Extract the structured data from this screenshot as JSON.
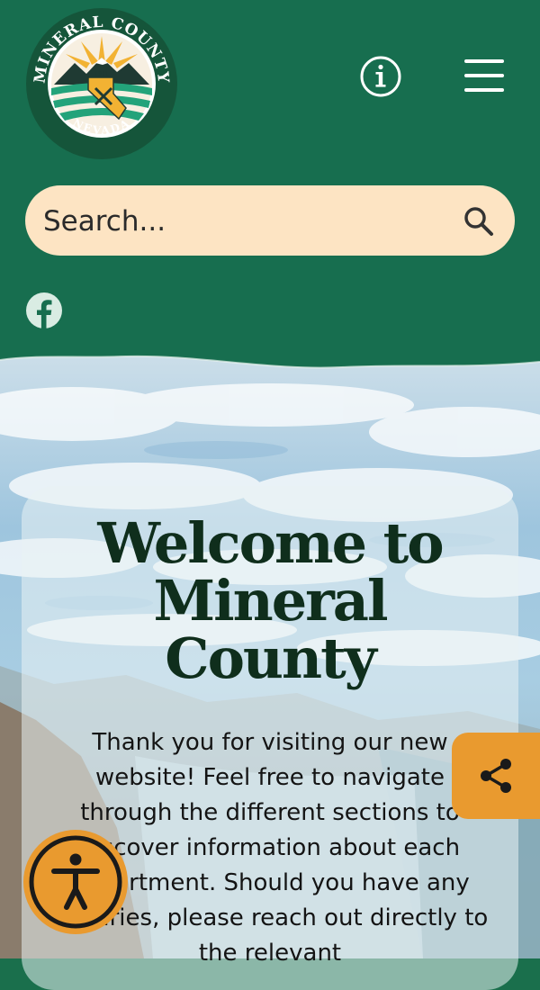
{
  "header": {
    "seal": {
      "top_text": "MINERAL COUNTY",
      "bottom_text": "NEVADA",
      "year": "1911",
      "colors": {
        "ring": "#15553a",
        "sun": "#f2b233",
        "field_green": "#23a37a",
        "map": "#f2b233"
      }
    },
    "info_icon": "info-icon",
    "menu_icon": "hamburger-menu-icon"
  },
  "search": {
    "placeholder": "Search...",
    "icon": "search-icon"
  },
  "social": {
    "facebook_icon": "facebook-icon"
  },
  "hero": {
    "title_lines": [
      "Welcome to",
      "Mineral",
      "County"
    ],
    "intro": "Thank you for visiting our new website! Feel free to navigate through the different sections to discover information about each department. Should you have any inquiries, please reach out directly to the relevant"
  },
  "floating": {
    "share_icon": "share-icon",
    "accessibility_icon": "accessibility-icon"
  },
  "colors": {
    "header_green": "#176e4f",
    "search_bg": "#fde4c3",
    "accent_orange": "#e99a2f",
    "title_text": "#0f2e1c"
  }
}
